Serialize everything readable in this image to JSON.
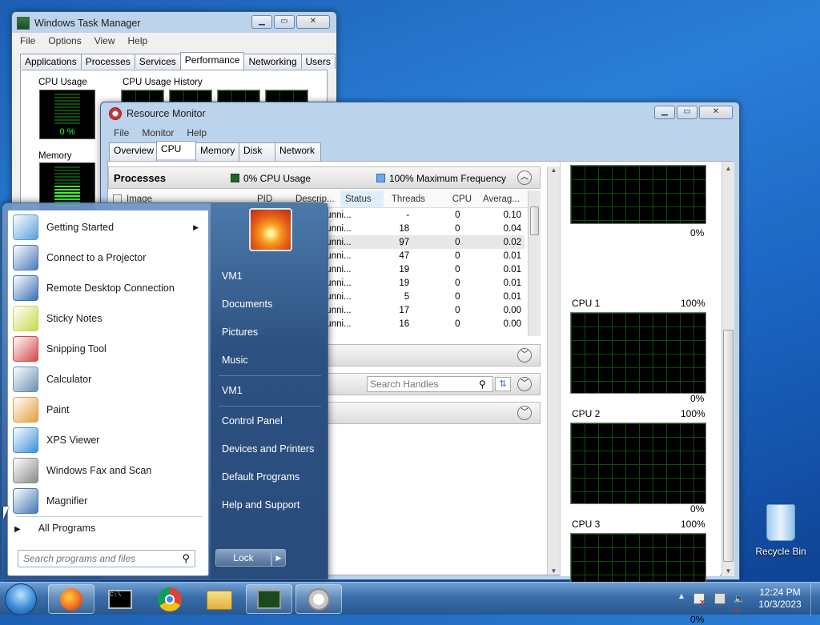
{
  "task_manager": {
    "title": "Windows Task Manager",
    "menu": [
      "File",
      "Options",
      "View",
      "Help"
    ],
    "tabs": [
      "Applications",
      "Processes",
      "Services",
      "Performance",
      "Networking",
      "Users"
    ],
    "active_tab": "Performance",
    "cpu_usage_label": "CPU Usage",
    "cpu_usage_value": "0 %",
    "cpu_history_label": "CPU Usage History",
    "memory_label": "Memory"
  },
  "resource_monitor": {
    "title": "Resource Monitor",
    "menu": [
      "File",
      "Monitor",
      "Help"
    ],
    "tabs": [
      "Overview",
      "CPU",
      "Memory",
      "Disk",
      "Network"
    ],
    "active_tab": "CPU",
    "processes_header": "Processes",
    "cpu_usage_legend": "0% CPU Usage",
    "max_freq_legend": "100% Maximum Frequency",
    "columns": [
      "Image",
      "PID",
      "Descrip...",
      "Status",
      "Threads",
      "CPU",
      "Averag..."
    ],
    "rows": [
      {
        "status": "Runni...",
        "threads": "-",
        "cpu": "0",
        "avg": "0.10"
      },
      {
        "status": "Runni...",
        "threads": "18",
        "cpu": "0",
        "avg": "0.04"
      },
      {
        "status": "Runni...",
        "threads": "97",
        "cpu": "0",
        "avg": "0.02"
      },
      {
        "status": "Runni...",
        "threads": "47",
        "cpu": "0",
        "avg": "0.01"
      },
      {
        "status": "Runni...",
        "threads": "19",
        "cpu": "0",
        "avg": "0.01"
      },
      {
        "status": "Runni...",
        "threads": "19",
        "cpu": "0",
        "avg": "0.01"
      },
      {
        "status": "Runni...",
        "threads": "5",
        "cpu": "0",
        "avg": "0.01"
      },
      {
        "status": "Runni...",
        "threads": "17",
        "cpu": "0",
        "avg": "0.00"
      },
      {
        "status": "Runni...",
        "threads": "16",
        "cpu": "0",
        "avg": "0.00"
      }
    ],
    "search_handles_placeholder": "Search Handles",
    "cpu_graphs": [
      {
        "label": "",
        "top": "",
        "bottom": "0%"
      },
      {
        "label": "CPU 1",
        "top": "100%",
        "bottom": "0%"
      },
      {
        "label": "CPU 2",
        "top": "100%",
        "bottom": "0%"
      },
      {
        "label": "CPU 3",
        "top": "100%",
        "bottom": "0%"
      }
    ]
  },
  "start_menu": {
    "programs": [
      {
        "label": "Getting Started",
        "icon": "getting-started-icon",
        "color": "#5aa0d8",
        "arrow": true
      },
      {
        "label": "Connect to a Projector",
        "icon": "projector-icon",
        "color": "#4a79b8"
      },
      {
        "label": "Remote Desktop Connection",
        "icon": "remote-desktop-icon",
        "color": "#3b6fb5"
      },
      {
        "label": "Sticky Notes",
        "icon": "sticky-notes-icon",
        "color": "#c9d94a"
      },
      {
        "label": "Snipping Tool",
        "icon": "snipping-tool-icon",
        "color": "#d24848"
      },
      {
        "label": "Calculator",
        "icon": "calculator-icon",
        "color": "#6b8fb4"
      },
      {
        "label": "Paint",
        "icon": "paint-icon",
        "color": "#e0a040"
      },
      {
        "label": "XPS Viewer",
        "icon": "xps-viewer-icon",
        "color": "#3c8fd8"
      },
      {
        "label": "Windows Fax and Scan",
        "icon": "fax-scan-icon",
        "color": "#8a8a8a"
      },
      {
        "label": "Magnifier",
        "icon": "magnifier-icon",
        "color": "#4577b0"
      }
    ],
    "all_programs": "All Programs",
    "search_placeholder": "Search programs and files",
    "right_links": [
      "VM1",
      "Documents",
      "Pictures",
      "Music",
      "VM1",
      "Control Panel",
      "Devices and Printers",
      "Default Programs",
      "Help and Support"
    ],
    "lock_label": "Lock"
  },
  "desktop": {
    "recycle_bin": "Recycle Bin"
  },
  "taskbar": {
    "time": "12:24 PM",
    "date": "10/3/2023",
    "buttons": [
      "start-orb",
      "firefox-icon",
      "command-prompt-icon",
      "chrome-icon",
      "file-explorer-icon",
      "task-manager-icon",
      "resource-monitor-icon"
    ]
  }
}
